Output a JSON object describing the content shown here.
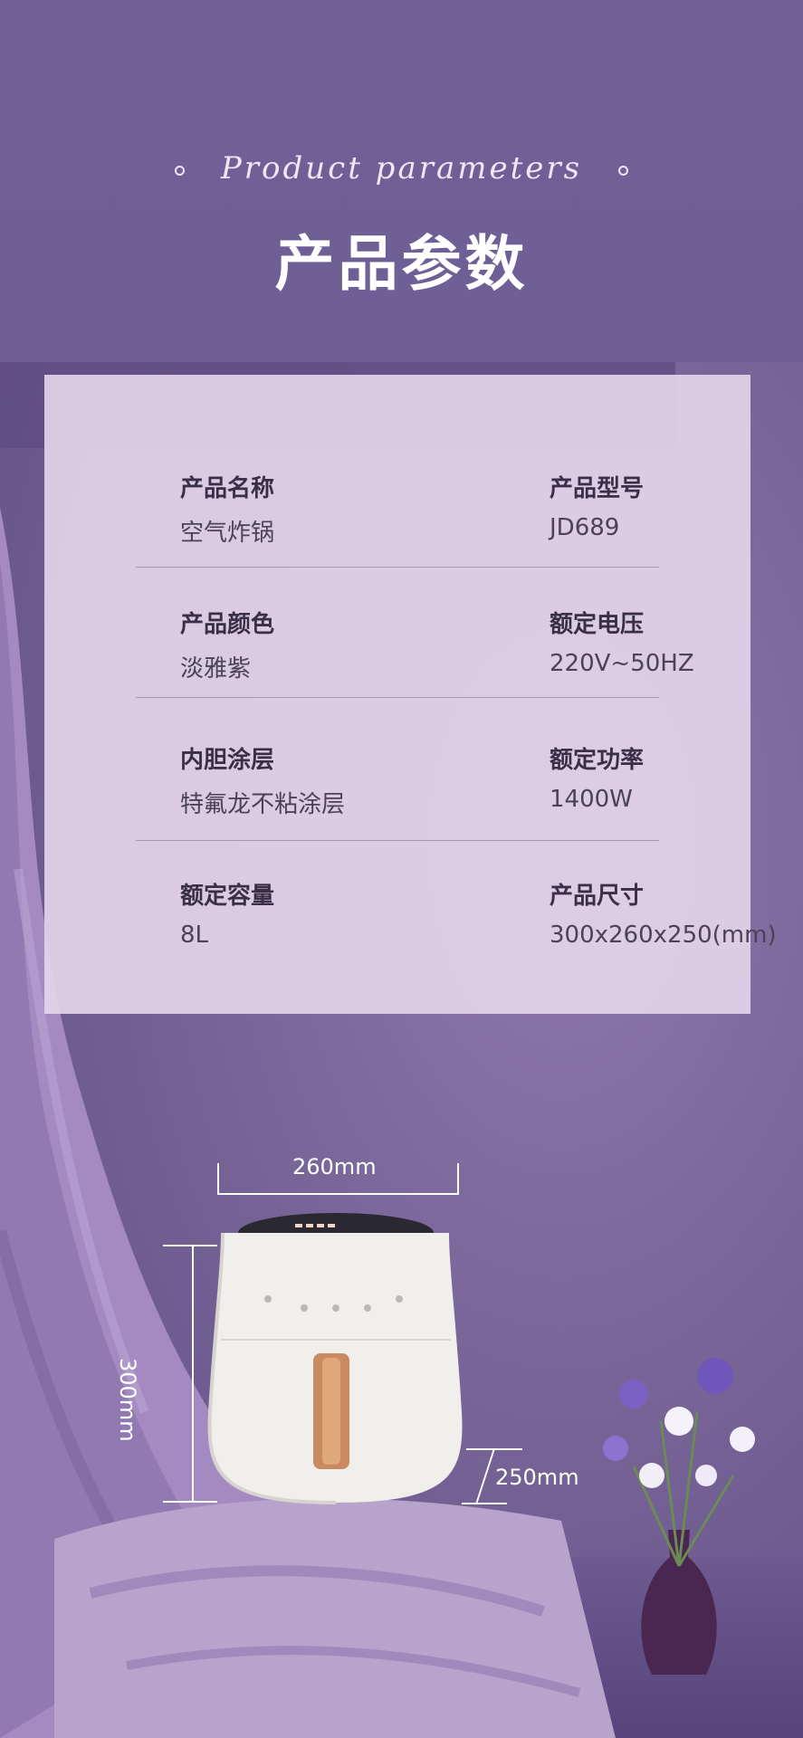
{
  "header": {
    "en_title": "Product parameters",
    "cn_title": "产品参数"
  },
  "params": [
    {
      "label_left": "产品名称",
      "value_left": "空气炸锅",
      "label_right": "产品型号",
      "value_right": "JD689"
    },
    {
      "label_left": "产品颜色",
      "value_left": "淡雅紫",
      "label_right": "额定电压",
      "value_right": "220V~50HZ"
    },
    {
      "label_left": "内胆涂层",
      "value_left": "特氟龙不粘涂层",
      "label_right": "额定功率",
      "value_right": "1400W"
    },
    {
      "label_left": "额定容量",
      "value_left": "8L",
      "label_right": "产品尺寸",
      "value_right": "300x260x250(mm)"
    }
  ],
  "dimensions": {
    "width": "260mm",
    "height": "300mm",
    "depth": "250mm"
  },
  "colors": {
    "accent": "#6f5f97",
    "panel": "#e3d4e9",
    "handle": "#c98a62"
  }
}
